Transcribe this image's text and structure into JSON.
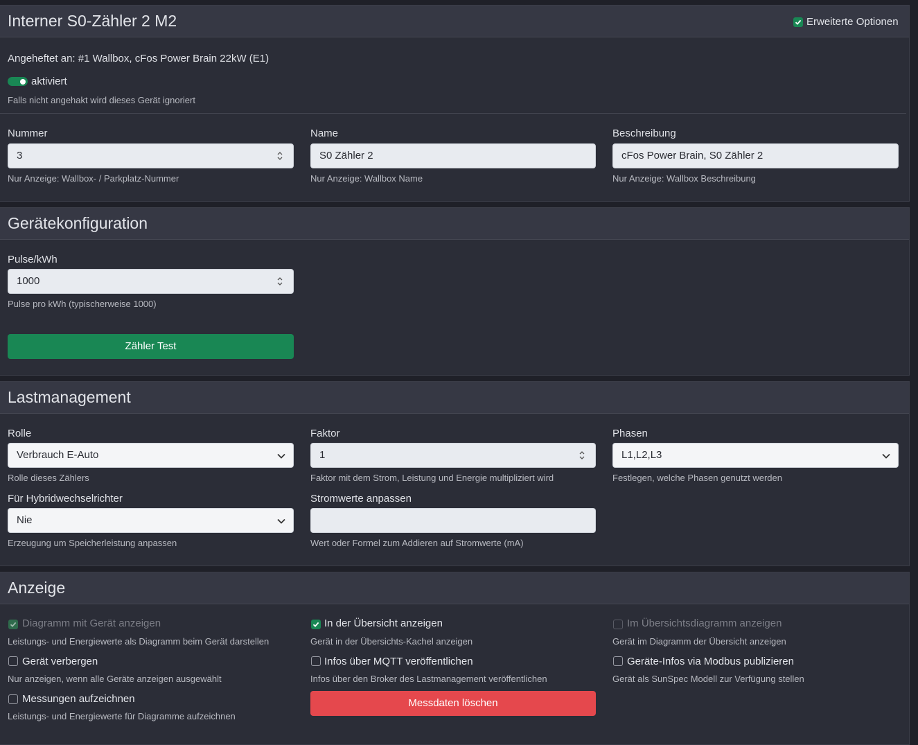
{
  "device": {
    "title": "Interner S0-Zähler 2 M2",
    "advanced_options_label": "Erweiterte Optionen",
    "advanced_options_checked": true,
    "attached_to": "Angeheftet an: #1 Wallbox, cFos Power Brain 22kW (E1)",
    "enabled_label": "aktiviert",
    "enabled": true,
    "enabled_hint": "Falls nicht angehakt wird dieses Gerät ignoriert",
    "fields": {
      "number": {
        "label": "Nummer",
        "value": "3",
        "hint": "Nur Anzeige: Wallbox- / Parkplatz-Nummer"
      },
      "name": {
        "label": "Name",
        "value": "S0 Zähler 2",
        "hint": "Nur Anzeige: Wallbox Name"
      },
      "description": {
        "label": "Beschreibung",
        "value": "cFos Power Brain, S0 Zähler 2",
        "hint": "Nur Anzeige: Wallbox Beschreibung"
      }
    }
  },
  "config": {
    "title": "Gerätekonfiguration",
    "pulse_label": "Pulse/kWh",
    "pulse_value": "1000",
    "pulse_hint": "Pulse pro kWh (typischerweise 1000)",
    "test_button": "Zähler Test"
  },
  "load": {
    "title": "Lastmanagement",
    "role": {
      "label": "Rolle",
      "value": "Verbrauch E-Auto",
      "hint": "Rolle dieses Zählers"
    },
    "factor": {
      "label": "Faktor",
      "value": "1",
      "hint": "Faktor mit dem Strom, Leistung und Energie multipliziert wird"
    },
    "phases": {
      "label": "Phasen",
      "value": "L1,L2,L3",
      "hint": "Festlegen, welche Phasen genutzt werden"
    },
    "hybrid": {
      "label": "Für Hybridwechselrichter",
      "value": "Nie",
      "hint": "Erzeugung um Speicherleistung anpassen"
    },
    "current_adjust": {
      "label": "Stromwerte anpassen",
      "value": "",
      "hint": "Wert oder Formel zum Addieren auf Stromwerte (mA)"
    }
  },
  "display": {
    "title": "Anzeige",
    "options": {
      "diagram": {
        "label": "Diagramm mit Gerät anzeigen",
        "hint": "Leistungs- und Energiewerte als Diagramm beim Gerät darstellen",
        "checked": true,
        "disabled": true
      },
      "overview": {
        "label": "In der Übersicht anzeigen",
        "hint": "Gerät in der Übersichts-Kachel anzeigen",
        "checked": true,
        "disabled": false
      },
      "overview_diagram": {
        "label": "Im Übersichtsdiagramm anzeigen",
        "hint": "Gerät im Diagramm der Übersicht anzeigen",
        "checked": false,
        "disabled": true
      },
      "hide": {
        "label": "Gerät verbergen",
        "hint": "Nur anzeigen, wenn alle Geräte anzeigen ausgewählt",
        "checked": false,
        "disabled": false
      },
      "mqtt": {
        "label": "Infos über MQTT veröffentlichen",
        "hint": "Infos über den Broker des Lastmanagement veröffentlichen",
        "checked": false,
        "disabled": false
      },
      "modbus": {
        "label": "Geräte-Infos via Modbus publizieren",
        "hint": "Gerät als SunSpec Modell zur Verfügung stellen",
        "checked": false,
        "disabled": false
      },
      "record": {
        "label": "Messungen aufzeichnen",
        "hint": "Leistungs- und Energiewerte für Diagramme aufzeichnen",
        "checked": false,
        "disabled": false
      }
    },
    "delete_button": "Messdaten löschen"
  },
  "colors": {
    "accent_green": "#198754",
    "danger_red": "#e5484d",
    "background": "#1f2028",
    "card": "#2b2d37"
  }
}
